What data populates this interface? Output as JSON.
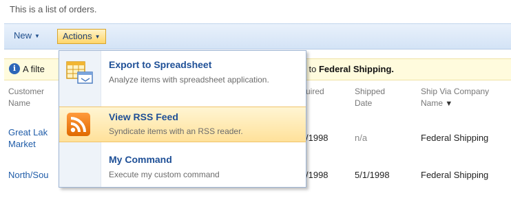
{
  "page": {
    "description": "This is a list of orders."
  },
  "toolbar": {
    "new_label": "New",
    "actions_label": "Actions"
  },
  "infobar": {
    "left_text": "A filte",
    "right_text": "l to",
    "right_bold": "Federal Shipping."
  },
  "table": {
    "headers": {
      "customer": [
        "Customer",
        "Name"
      ],
      "required": "uired",
      "shipped": [
        "Shipped",
        "Date"
      ],
      "ship_via": [
        "Ship Via Company",
        "Name"
      ]
    },
    "rows": [
      {
        "customer": [
          "Great Lak",
          "Market"
        ],
        "required": "/1998",
        "shipped": "n/a",
        "ship_via": "Federal Shipping"
      },
      {
        "customer": [
          "North/Sou"
        ],
        "required": "/1998",
        "shipped": "5/1/1998",
        "ship_via": "Federal Shipping"
      }
    ]
  },
  "actions_menu": {
    "items": [
      {
        "title": "Export to Spreadsheet",
        "description": "Analyze items with spreadsheet application.",
        "icon": "spreadsheet-icon",
        "highlighted": false
      },
      {
        "title": "View RSS Feed",
        "description": "Syndicate items with an RSS reader.",
        "icon": "rss-icon",
        "highlighted": true
      },
      {
        "title": "My Command",
        "description": "Execute my custom command",
        "icon": "none",
        "highlighted": false
      }
    ]
  }
}
